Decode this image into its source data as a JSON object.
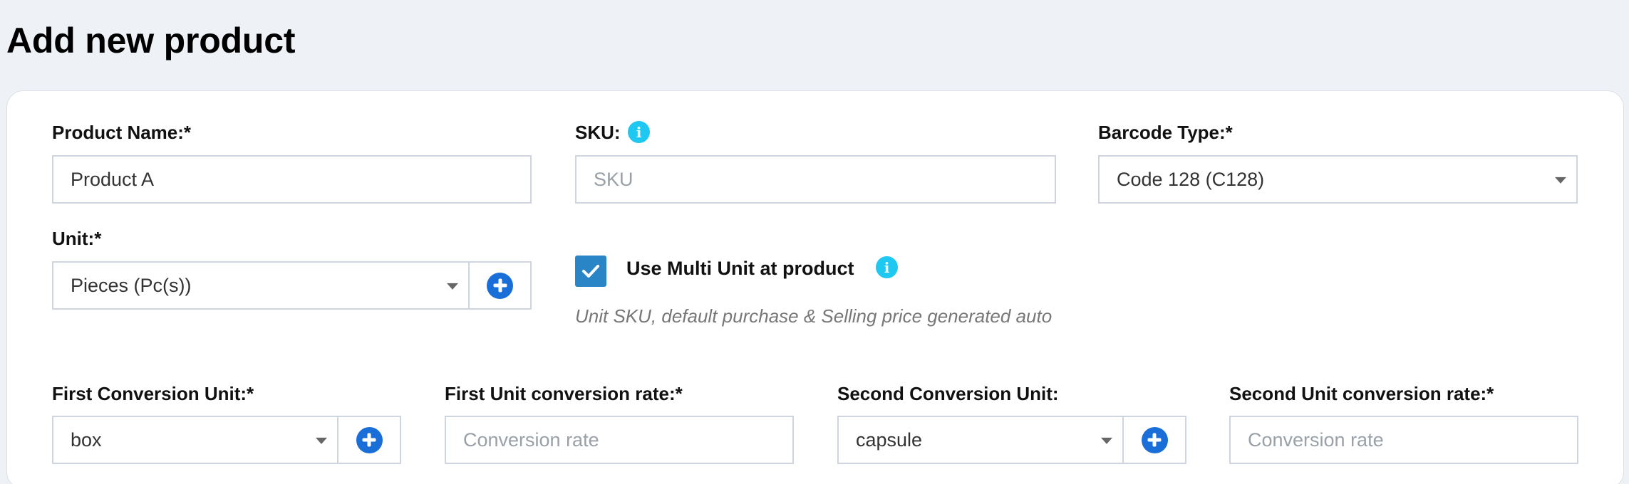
{
  "page": {
    "title": "Add new product"
  },
  "form": {
    "product_name": {
      "label": "Product Name:*",
      "value": "Product A"
    },
    "sku": {
      "label": "SKU:",
      "placeholder": "SKU",
      "info_icon": "info-icon"
    },
    "barcode_type": {
      "label": "Barcode Type:*",
      "selected": "Code 128 (C128)"
    },
    "unit": {
      "label": "Unit:*",
      "selected": "Pieces (Pc(s))",
      "add_icon": "plus-circle-icon"
    },
    "multi_unit": {
      "label": "Use Multi Unit at product",
      "checked": true,
      "hint": "Unit SKU, default purchase & Selling price generated auto"
    },
    "first_conversion_unit": {
      "label": "First Conversion Unit:*",
      "selected": "box"
    },
    "first_unit_rate": {
      "label": "First Unit conversion rate:*",
      "placeholder": "Conversion rate"
    },
    "second_conversion_unit": {
      "label": "Second Conversion Unit:",
      "selected": "capsule"
    },
    "second_unit_rate": {
      "label": "Second Unit conversion rate:*",
      "placeholder": "Conversion rate"
    }
  },
  "colors": {
    "accent_blue": "#1a6ed8",
    "checkbox_blue": "#2a85c7",
    "info_cyan": "#1ec8f0",
    "background": "#eef1f5"
  }
}
